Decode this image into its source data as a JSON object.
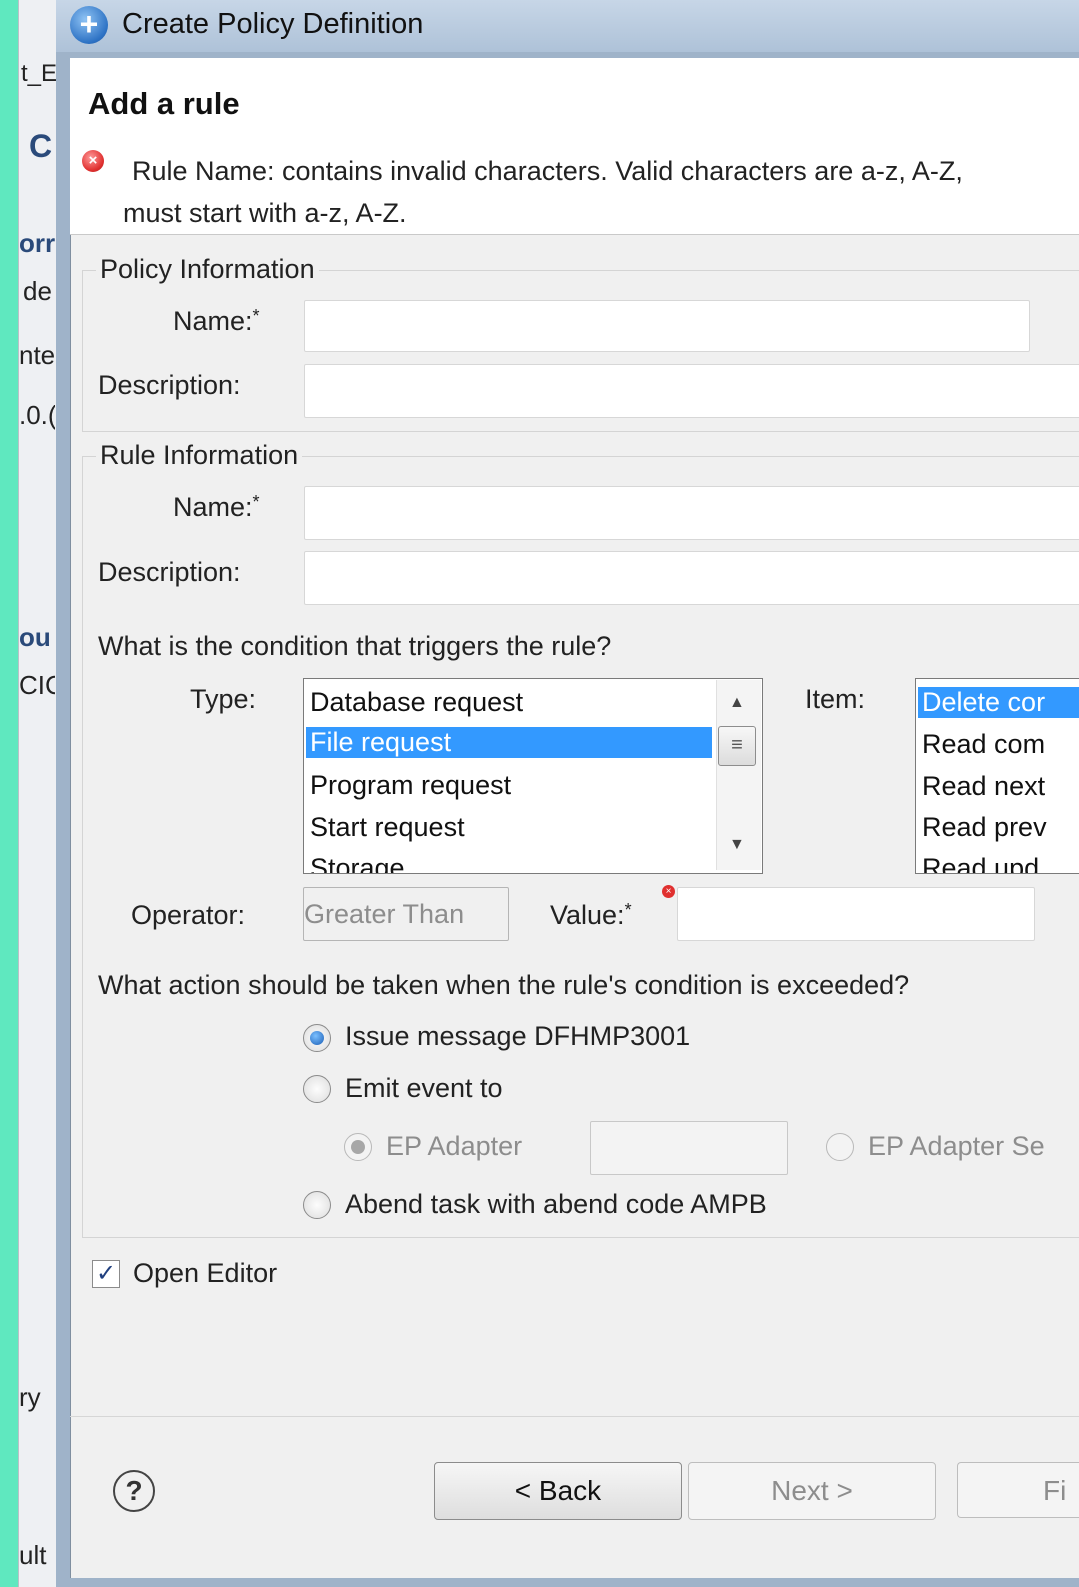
{
  "background_window": {
    "fragments": [
      "t_E",
      "C",
      "orr",
      "de",
      "nte",
      ".0.(",
      "ou",
      "CIC",
      "ry",
      "ult"
    ]
  },
  "window": {
    "title": "Create Policy Definition"
  },
  "header": {
    "title": "Add a rule",
    "error_line1": "Rule Name: contains invalid characters. Valid characters are a-z, A-Z,",
    "error_line2": "must start with a-z, A-Z."
  },
  "policy_info": {
    "group_label": "Policy Information",
    "name_label": "Name:",
    "required_mark": "*",
    "name_value": "",
    "description_label": "Description:",
    "description_value": ""
  },
  "rule_info": {
    "group_label": "Rule Information",
    "name_label": "Name:",
    "required_mark": "*",
    "name_value": "",
    "description_label": "Description:",
    "description_value": "",
    "condition_question": "What is the condition that triggers the rule?",
    "type_label": "Type:",
    "type_options": [
      "Database request",
      "File request",
      "Program request",
      "Start request",
      "Storage"
    ],
    "type_selected": "File request",
    "item_label": "Item:",
    "item_options": [
      "Delete cor",
      "Read com",
      "Read next",
      "Read prev",
      "Read upd"
    ],
    "item_selected": "Delete cor",
    "operator_label": "Operator:",
    "operator_value": "Greater Than",
    "value_label": "Value:",
    "value_required_mark": "*",
    "value_value": "",
    "action_question": "What action should be taken when the rule's condition is exceeded?",
    "actions": {
      "issue_message": "Issue message DFHMP3001",
      "emit_event": "Emit event to",
      "ep_adapter": "EP Adapter",
      "ep_adapter_value": "",
      "ep_adapter_set": "EP Adapter Se",
      "abend_task": "Abend task with abend code AMPB"
    },
    "selected_action": "issue_message"
  },
  "open_editor": {
    "label": "Open Editor",
    "checked": true
  },
  "footer": {
    "help_glyph": "?",
    "back_label": "< Back",
    "next_label": "Next >",
    "finish_label": "Fi"
  },
  "colors": {
    "selection": "#3399ff",
    "error": "#e0302f",
    "accent": "#5fe8bf"
  }
}
